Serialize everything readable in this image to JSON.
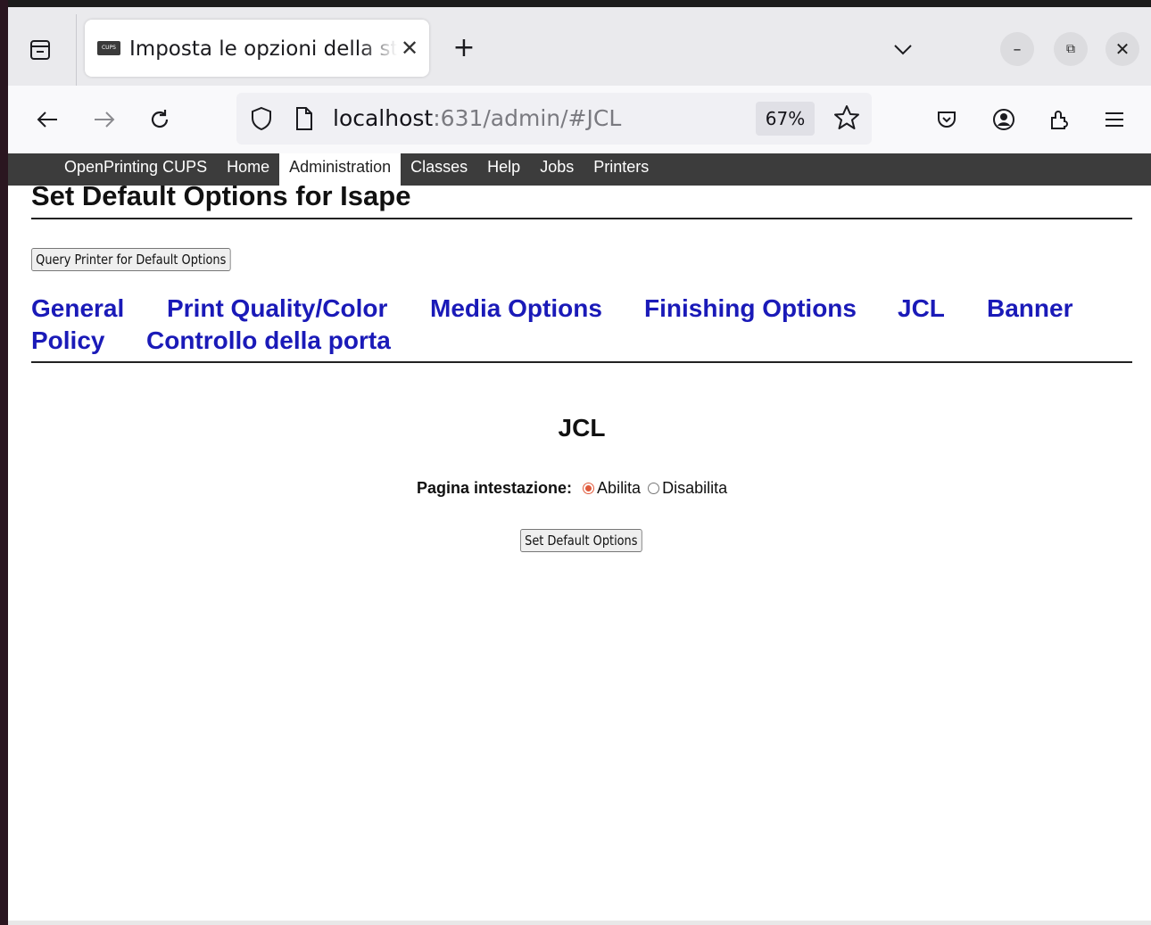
{
  "browser": {
    "tab_title": "Imposta le opzioni della stampante",
    "favicon_text": "CUPS",
    "tab_close_glyph": "✕",
    "new_tab_glyph": "+",
    "window_minimize_glyph": "–",
    "window_maximize_glyph": "⧉",
    "window_close_glyph": "✕",
    "url_host": "localhost",
    "url_rest": ":631/admin/#JCL",
    "zoom": "67%"
  },
  "cups_nav": {
    "items": [
      {
        "label": "OpenPrinting CUPS",
        "active": false
      },
      {
        "label": "Home",
        "active": false
      },
      {
        "label": "Administration",
        "active": true
      },
      {
        "label": "Classes",
        "active": false
      },
      {
        "label": "Help",
        "active": false
      },
      {
        "label": "Jobs",
        "active": false
      },
      {
        "label": "Printers",
        "active": false
      }
    ]
  },
  "page": {
    "title": "Set Default Options for Isape",
    "query_button": "Query Printer for Default Options",
    "option_tabs": [
      "General",
      "Print Quality/Color",
      "Media Options",
      "Finishing Options",
      "JCL",
      "Banner",
      "Policy",
      "Controllo della porta"
    ],
    "section_title": "JCL",
    "option_label": "Pagina intestazione:",
    "radio_options": [
      {
        "label": "Abilita",
        "checked": true
      },
      {
        "label": "Disabilita",
        "checked": false
      }
    ],
    "submit_button": "Set Default Options"
  },
  "colors": {
    "link": "#1a1ab8",
    "header_bg": "#3c3c3c",
    "radio_accent": "#e05a3c"
  }
}
